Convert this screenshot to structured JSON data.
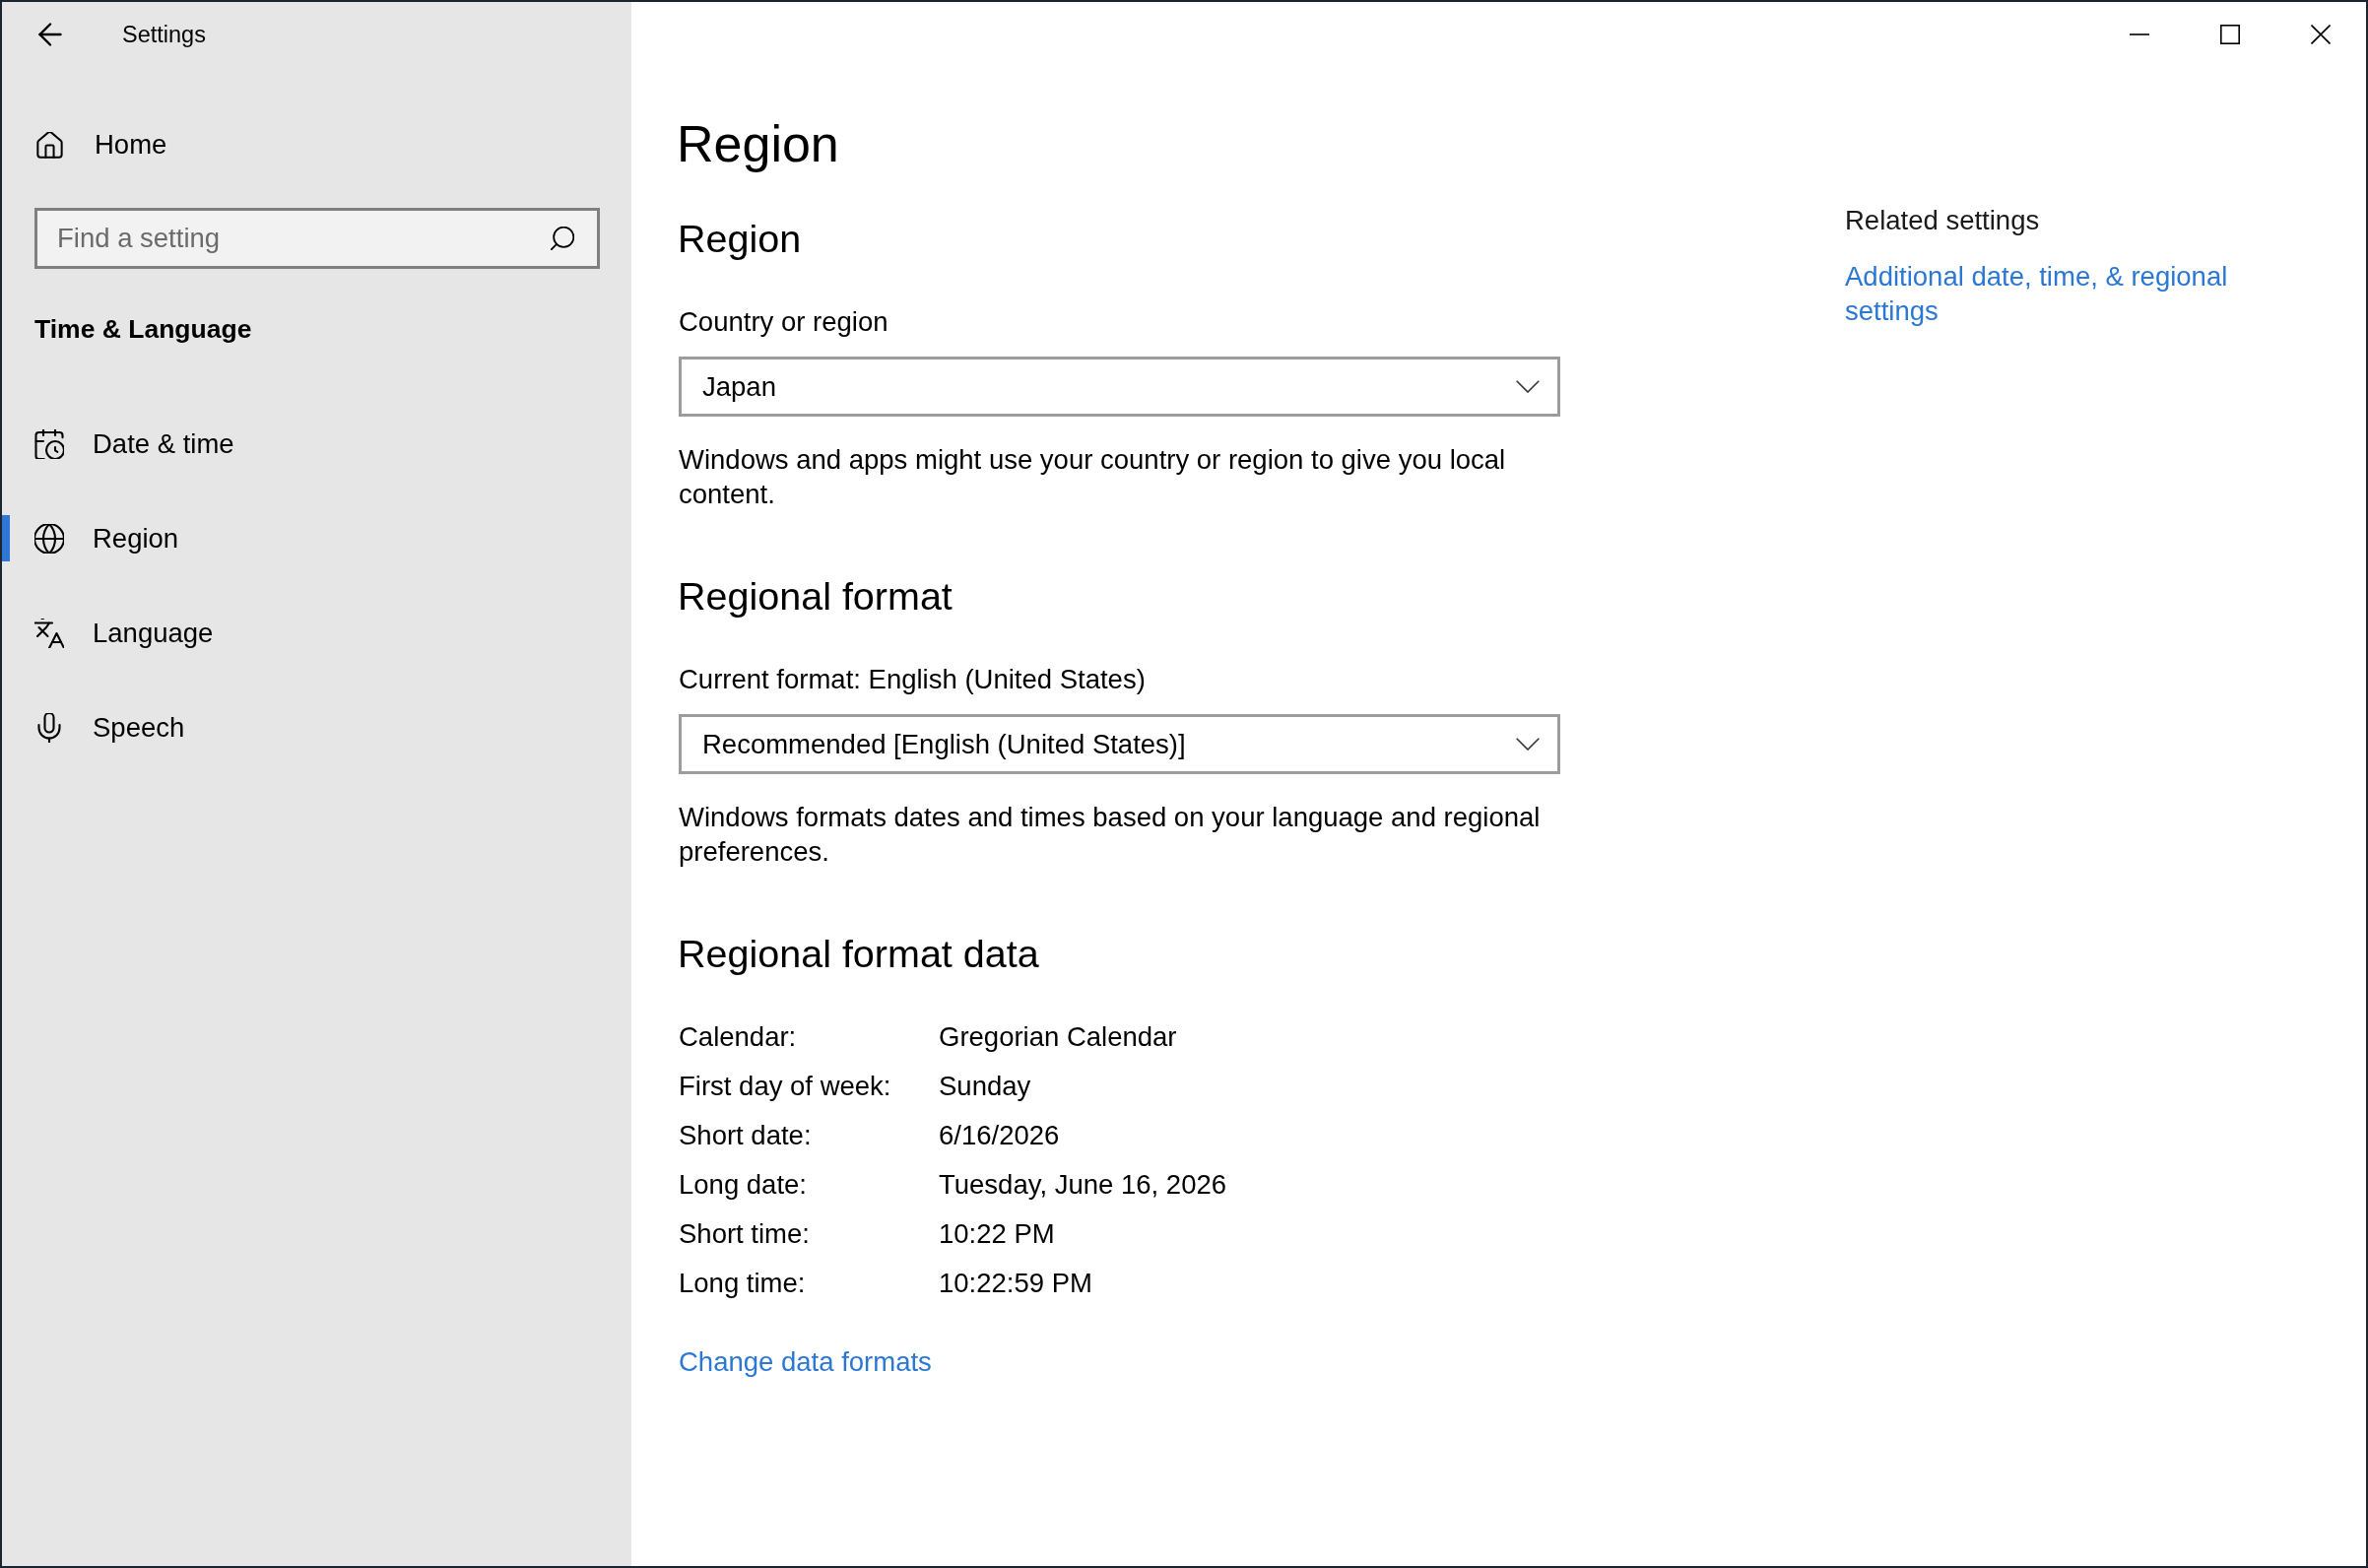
{
  "window": {
    "title": "Settings"
  },
  "sidebar": {
    "home": "Home",
    "search": {
      "placeholder": "Find a setting"
    },
    "section_title": "Time & Language",
    "items": [
      {
        "label": "Date & time",
        "selected": false
      },
      {
        "label": "Region",
        "selected": true
      },
      {
        "label": "Language",
        "selected": false
      },
      {
        "label": "Speech",
        "selected": false
      }
    ]
  },
  "page": {
    "title": "Region",
    "sections": [
      {
        "heading": "Region",
        "label": "Country or region",
        "dropdown": {
          "value": "Japan"
        },
        "description": "Windows and apps might use your country or region to give you local content."
      },
      {
        "heading": "Regional format",
        "label": "Current format: English (United States)",
        "dropdown": {
          "value": "Recommended [English (United States)]"
        },
        "description": "Windows formats dates and times based on your language and regional preferences."
      }
    ],
    "format_data": {
      "heading": "Regional format data",
      "rows": [
        {
          "label": "Calendar:",
          "value": "Gregorian Calendar"
        },
        {
          "label": "First day of week:",
          "value": "Sunday"
        },
        {
          "label": "Short date:",
          "value": "6/16/2026"
        },
        {
          "label": "Long date:",
          "value": "Tuesday, June 16, 2026"
        },
        {
          "label": "Short time:",
          "value": "10:22 PM"
        },
        {
          "label": "Long time:",
          "value": "10:22:59 PM"
        }
      ],
      "link": "Change data formats"
    }
  },
  "related_settings": {
    "heading": "Related settings",
    "links": [
      "Additional date, time, & regional settings"
    ]
  }
}
